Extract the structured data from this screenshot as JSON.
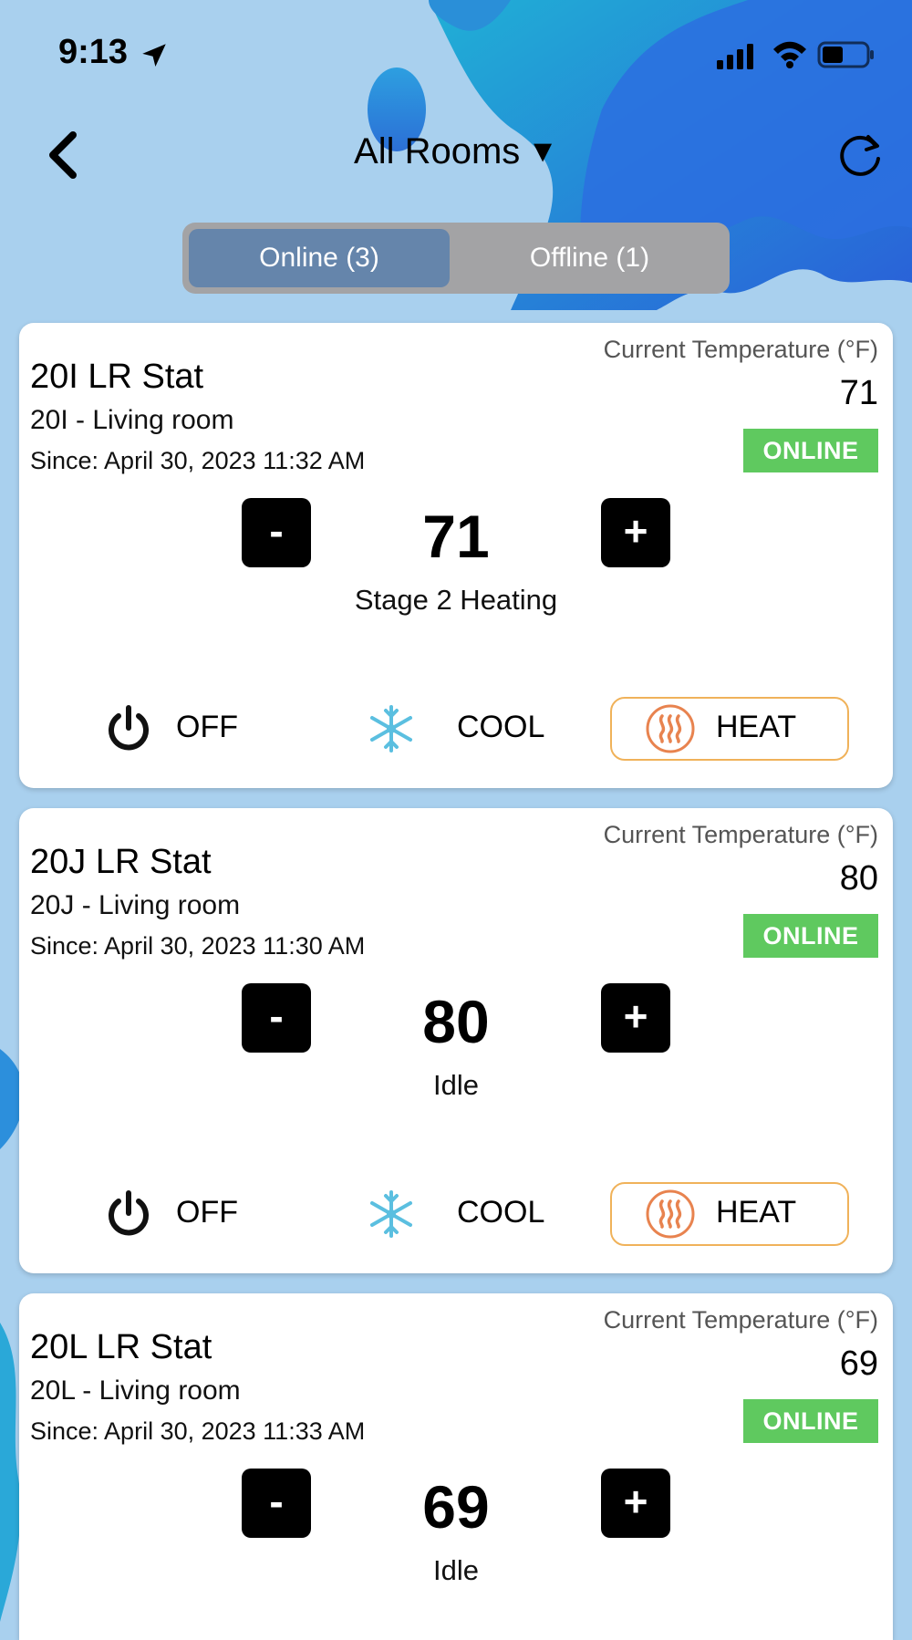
{
  "status_bar": {
    "time": "9:13"
  },
  "header": {
    "title": "All Rooms",
    "dropdown_glyph": "▼"
  },
  "tabs": [
    {
      "label": "Online (3)",
      "active": true
    },
    {
      "label": "Offline (1)",
      "active": false
    }
  ],
  "card_common": {
    "current_temp_label": "Current Temperature (°F)"
  },
  "thermostats": [
    {
      "name": "20I LR Stat",
      "location": "20I - Living room",
      "since": "Since: April 30, 2023 11:32 AM",
      "current_temp": "71",
      "status": "ONLINE",
      "setpoint": "71",
      "hvac_state": "Stage 2 Heating",
      "minus": "-",
      "plus": "+",
      "modes": [
        {
          "label": "OFF"
        },
        {
          "label": "COOL"
        },
        {
          "label": "HEAT"
        }
      ],
      "selected_mode": "HEAT"
    },
    {
      "name": "20J LR Stat",
      "location": "20J - Living room",
      "since": "Since: April 30, 2023 11:30 AM",
      "current_temp": "80",
      "status": "ONLINE",
      "setpoint": "80",
      "hvac_state": "Idle",
      "minus": "-",
      "plus": "+",
      "modes": [
        {
          "label": "OFF"
        },
        {
          "label": "COOL"
        },
        {
          "label": "HEAT"
        }
      ],
      "selected_mode": "HEAT"
    },
    {
      "name": "20L LR Stat",
      "location": "20L - Living room",
      "since": "Since: April 30, 2023 11:33 AM",
      "current_temp": "69",
      "status": "ONLINE",
      "setpoint": "69",
      "hvac_state": "Idle",
      "minus": "-",
      "plus": "+"
    }
  ],
  "colors": {
    "background": "#a9d0ee",
    "accent_blue": "#2f6fd8",
    "tab_active": "#6585ab",
    "tab_inactive": "#a3a3a5",
    "online_badge": "#5fc95f",
    "heat_accent": "#f0b25a",
    "heat_icon": "#e8834f",
    "cool_icon": "#5bbfe0"
  },
  "icons": {
    "status_bar": [
      "location-arrow-icon",
      "cellular-signal-icon",
      "wifi-icon",
      "battery-icon"
    ],
    "header": [
      "back-chevron-icon",
      "refresh-icon"
    ],
    "modes": [
      "power-icon",
      "snowflake-icon",
      "heat-waves-icon"
    ]
  }
}
